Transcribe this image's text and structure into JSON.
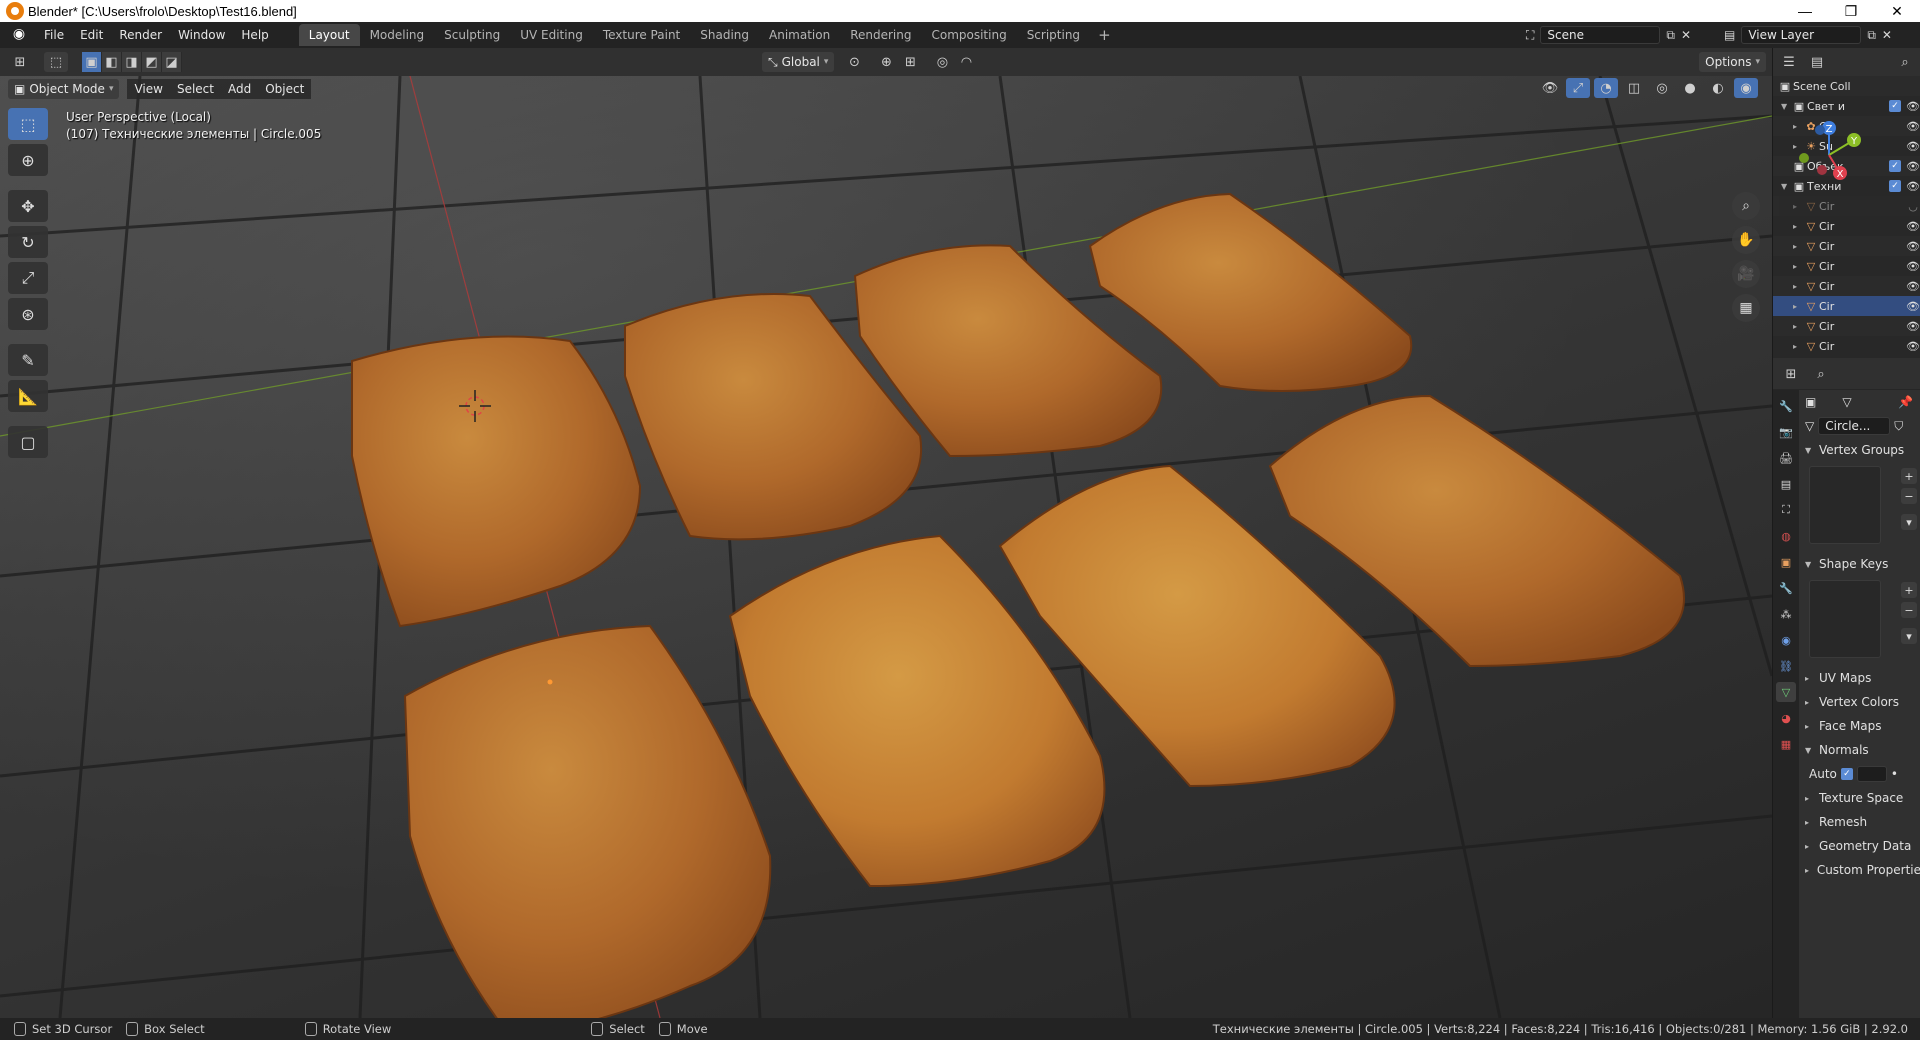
{
  "window": {
    "title": "Blender* [C:\\Users\\frolo\\Desktop\\Test16.blend]",
    "min": "—",
    "max": "❐",
    "close": "✕"
  },
  "menu": [
    "File",
    "Edit",
    "Render",
    "Window",
    "Help"
  ],
  "workspaces": [
    "Layout",
    "Modeling",
    "Sculpting",
    "UV Editing",
    "Texture Paint",
    "Shading",
    "Animation",
    "Rendering",
    "Compositing",
    "Scripting"
  ],
  "active_workspace": "Layout",
  "scene": "Scene",
  "view_layer": "View Layer",
  "tool_header": {
    "orientation": "Global",
    "options": "Options"
  },
  "view_header": {
    "mode": "Object Mode",
    "items": [
      "View",
      "Select",
      "Add",
      "Object"
    ]
  },
  "viewport": {
    "perspective": "User Perspective (Local)",
    "context": "(107) Технические элементы | Circle.005"
  },
  "outliner": {
    "title": "Scene Coll",
    "rows": [
      {
        "label": "Свет и",
        "indent": 1,
        "arrow": "▼",
        "icon": "▣",
        "check": true
      },
      {
        "label": "Ca",
        "indent": 2,
        "arrow": "▸",
        "icon": "✿",
        "check": false
      },
      {
        "label": "Su",
        "indent": 2,
        "arrow": "▸",
        "icon": "☀",
        "check": false
      },
      {
        "label": "Объек",
        "indent": 1,
        "arrow": "",
        "icon": "▣",
        "check": true
      },
      {
        "label": "Техни",
        "indent": 1,
        "arrow": "▼",
        "icon": "▣",
        "check": true
      },
      {
        "label": "Cir",
        "indent": 2,
        "arrow": "▸",
        "icon": "▽",
        "check": false
      },
      {
        "label": "Cir",
        "indent": 2,
        "arrow": "▸",
        "icon": "▽",
        "check": false
      },
      {
        "label": "Cir",
        "indent": 2,
        "arrow": "▸",
        "icon": "▽",
        "check": false
      },
      {
        "label": "Cir",
        "indent": 2,
        "arrow": "▸",
        "icon": "▽",
        "check": false
      },
      {
        "label": "Cir",
        "indent": 2,
        "arrow": "▸",
        "icon": "▽",
        "check": false
      },
      {
        "label": "Cir",
        "indent": 2,
        "arrow": "▸",
        "icon": "▽",
        "check": false
      },
      {
        "label": "Cir",
        "indent": 2,
        "arrow": "▸",
        "icon": "▽",
        "check": false
      },
      {
        "label": "Cir",
        "indent": 2,
        "arrow": "▸",
        "icon": "▽",
        "check": false
      }
    ]
  },
  "properties": {
    "mesh_name": "Circle...",
    "panels": {
      "vertex_groups": "Vertex Groups",
      "shape_keys": "Shape Keys",
      "uv_maps": "UV Maps",
      "vertex_colors": "Vertex Colors",
      "face_maps": "Face Maps",
      "normals": "Normals",
      "auto": "Auto",
      "texture_space": "Texture Space",
      "remesh": "Remesh",
      "geometry_data": "Geometry Data",
      "custom_properties": "Custom Propertie"
    }
  },
  "status": {
    "items": [
      "Set 3D Cursor",
      "Box Select",
      "Rotate View",
      "Select",
      "Move"
    ],
    "stats": "Технические элементы | Circle.005 | Verts:8,224 | Faces:8,224 | Tris:16,416 | Objects:0/281 | Memory: 1.56 GiB | 2.92.0"
  },
  "colors": {
    "accent": "#4772b3",
    "x_axis": "#e0414f",
    "y_axis": "#8cbf26",
    "z_axis": "#3f7fe0",
    "tile_base": "#b8732c"
  }
}
